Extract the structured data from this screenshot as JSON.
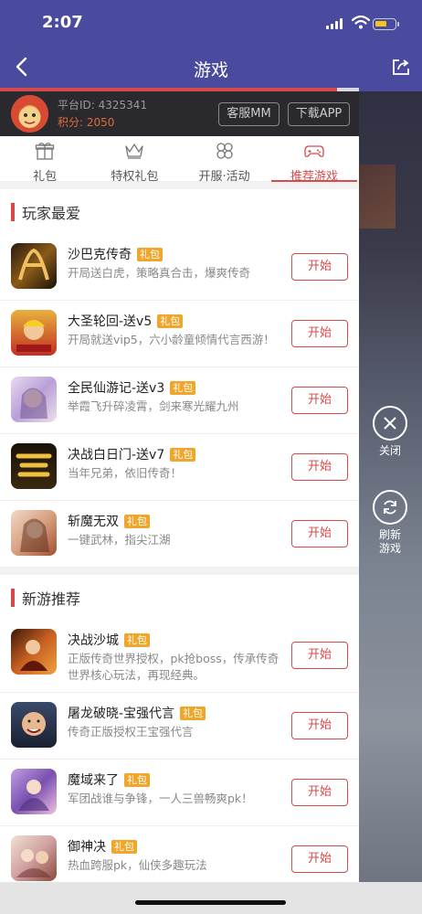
{
  "status_bar": {
    "time": "2:07"
  },
  "nav": {
    "title": "游戏"
  },
  "progress": 0.94,
  "user": {
    "platform_id": "平台ID: 4325341",
    "points_label": "积分: ",
    "points": "2050",
    "service_button": "客服MM",
    "download_button": "下载APP"
  },
  "tabs": [
    {
      "label": "礼包",
      "icon": "gift-icon"
    },
    {
      "label": "特权礼包",
      "icon": "crown-icon"
    },
    {
      "label": "开服·活动",
      "icon": "flower-icon"
    },
    {
      "label": "推荐游戏",
      "icon": "gamepad-icon",
      "active": true
    }
  ],
  "side": {
    "close": "关闭",
    "refresh_line1": "刷新",
    "refresh_line2": "游戏"
  },
  "sections": [
    {
      "title": "玩家最爱",
      "games": [
        {
          "name": "沙巴克传奇",
          "badge": "礼包",
          "desc": "开局送白虎，策略真合击，爆爽传奇",
          "button": "开始"
        },
        {
          "name": "大圣轮回-送v5",
          "badge": "礼包",
          "desc": "开局就送vip5，六小龄童倾情代言西游！",
          "button": "开始"
        },
        {
          "name": "全民仙游记-送v3",
          "badge": "礼包",
          "desc": "举霞飞升碎凌霄，剑来寒光耀九州",
          "button": "开始"
        },
        {
          "name": "决战白日门-送v7",
          "badge": "礼包",
          "desc": "当年兄弟，依旧传奇！",
          "button": "开始"
        },
        {
          "name": "斩魔无双",
          "badge": "礼包",
          "desc": "一键武林，指尖江湖",
          "button": "开始"
        }
      ]
    },
    {
      "title": "新游推荐",
      "games": [
        {
          "name": "决战沙城",
          "badge": "礼包",
          "desc": "正版传奇世界授权，pk抢boss，传承传奇世界核心玩法，再现经典。",
          "button": "开始"
        },
        {
          "name": "屠龙破晓-宝强代言",
          "badge": "礼包",
          "desc": "传奇正版授权王宝强代言",
          "button": "开始"
        },
        {
          "name": "魔域来了",
          "badge": "礼包",
          "desc": "军团战谁与争锋，一人三兽畅爽pk！",
          "button": "开始"
        },
        {
          "name": "御神决",
          "badge": "礼包",
          "desc": "热血跨服pk，仙侠多趣玩法",
          "button": "开始"
        }
      ]
    }
  ],
  "colors": {
    "header": "#4a4a9e",
    "accent": "#d64a4a",
    "badge": "#f0a62a"
  }
}
